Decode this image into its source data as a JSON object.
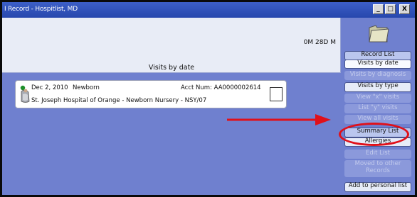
{
  "window": {
    "title": "I Record - Hospitlist, MD",
    "minimize": "_",
    "maximize": "□",
    "close": "X"
  },
  "header": {
    "age": "0M 28D M",
    "caption": "Visits by date"
  },
  "visit": {
    "date": "Dec 2, 2010",
    "type": "Newborn",
    "acct": "Acct Num:  AA0000002614",
    "location": "St. Joseph Hospital of Orange - Newborn Nursery - NSY/07"
  },
  "sidebar": {
    "record_list": "Record List",
    "visits_by_date": "Visits by date",
    "visits_by_diagnosis": "Visits by diagnosis",
    "visits_by_type": "Visits by type",
    "view_x_visits": "View \"x\" visits",
    "list_y_visits": "List \"y\" visits",
    "view_all_visits": "View all visits",
    "summary_list": "Summary List",
    "allergies": "Allergies",
    "edit_list": "Edit List",
    "moved_to_other": "Moved to other",
    "records": "Records",
    "add_to_personal_list": "Add to personal list"
  },
  "colors": {
    "background": "#6f80cf",
    "titlebar": "#2747ad",
    "highlight": "#e0101a"
  }
}
